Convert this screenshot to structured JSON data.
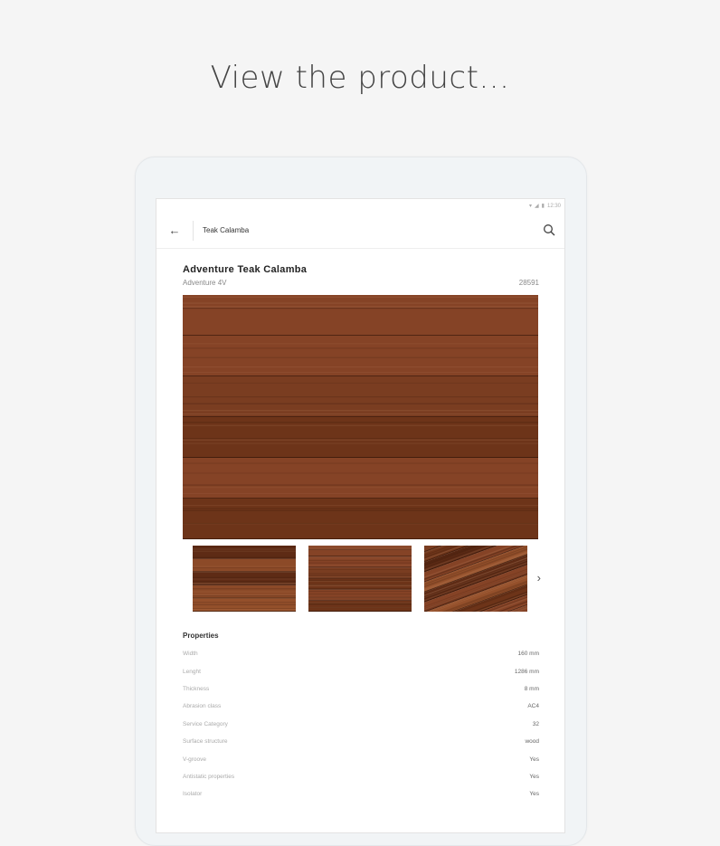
{
  "headline": "View the product...",
  "status_bar": {
    "time": "12:30"
  },
  "app_bar": {
    "title": "Teak Calamba"
  },
  "product": {
    "name": "Adventure Teak Calamba",
    "collection": "Adventure 4V",
    "code": "28591"
  },
  "properties": {
    "heading": "Properties",
    "rows": [
      {
        "label": "Width",
        "value": "160 mm"
      },
      {
        "label": "Lenght",
        "value": "1286 mm"
      },
      {
        "label": "Thickness",
        "value": "8 mm"
      },
      {
        "label": "Abrasion class",
        "value": "AC4"
      },
      {
        "label": "Service Category",
        "value": "32"
      },
      {
        "label": "Surface structure",
        "value": "wood"
      },
      {
        "label": "V-groove",
        "value": "Yes"
      },
      {
        "label": "Antistatic properties",
        "value": "Yes"
      },
      {
        "label": "Isolator",
        "value": "Yes"
      }
    ]
  },
  "colors": {
    "wood_base": "#7a3d21",
    "wood_light": "#94502b",
    "wood_dark": "#5e2b15"
  },
  "icons": {
    "back": "arrow-left-icon",
    "search": "search-icon",
    "next": "chevron-right-icon"
  }
}
